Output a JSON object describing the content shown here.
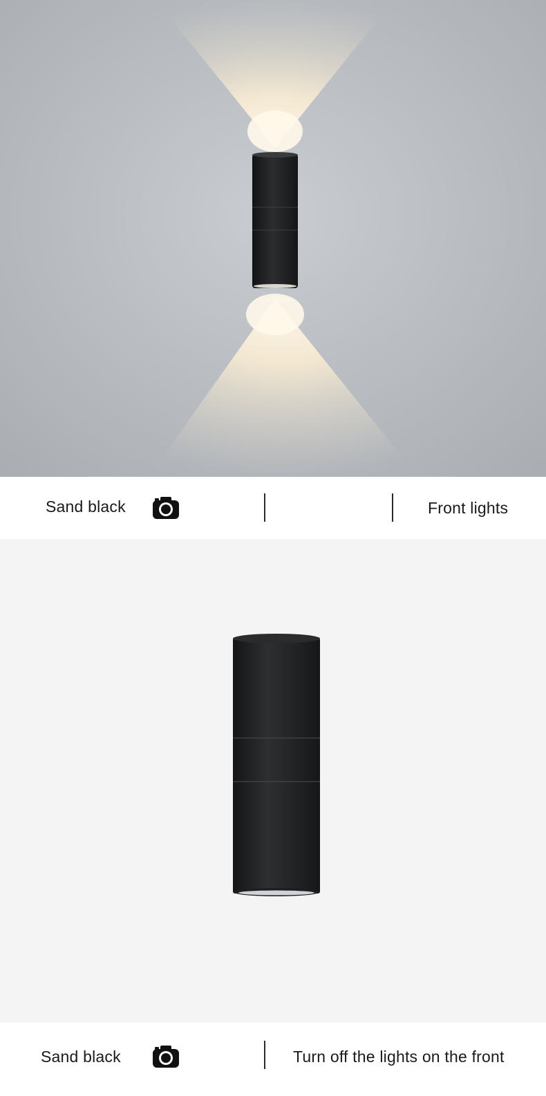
{
  "captions": [
    {
      "left_label": "Sand black",
      "icon": "camera-icon",
      "right_label": "Front lights"
    },
    {
      "left_label": "Sand black",
      "icon": "camera-icon",
      "right_label": "Turn off the lights on the front"
    }
  ],
  "colors": {
    "wall": "#bcc0c4",
    "lamp_body": "#232426",
    "warm_light": "#fff3d6",
    "product_bg": "#f4f4f4"
  }
}
